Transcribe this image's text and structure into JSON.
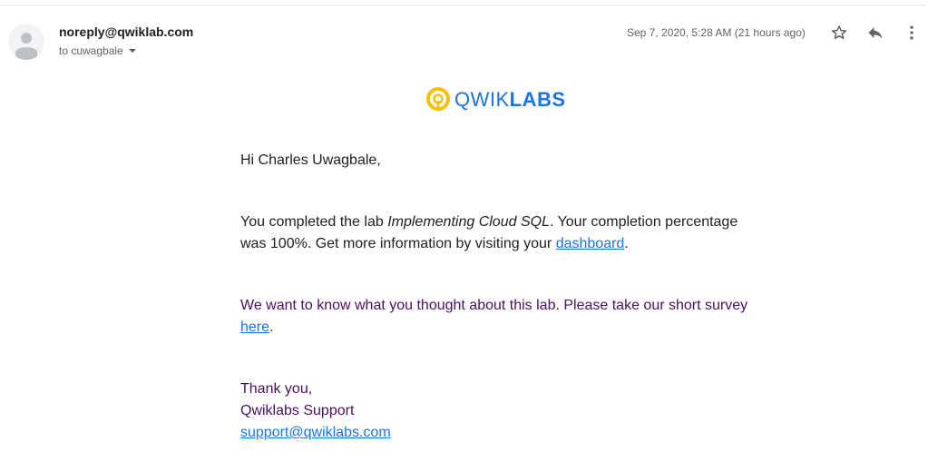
{
  "header": {
    "sender": "noreply@qwiklab.com",
    "recipient": "to cuwagbale",
    "timestamp": "Sep 7, 2020, 5:28 AM (21 hours ago)"
  },
  "icons": {
    "avatar": "person-icon",
    "star": "star-outline-icon",
    "reply": "reply-icon",
    "more": "more-vert-icon"
  },
  "logo": {
    "text_light": "QWIK",
    "text_bold": "LABS"
  },
  "email": {
    "greeting": "Hi Charles Uwagbale,",
    "p1_prefix": "You completed the lab ",
    "p1_lab": "Implementing Cloud SQL",
    "p1_mid": ". Your completion percentage was 100%. Get more information by visiting your ",
    "p1_link": "dashboard",
    "p1_suffix": ".",
    "p2_prefix": "We want to know what you thought about this lab. Please take our short survey ",
    "p2_link": "here",
    "p2_suffix": ".",
    "signoff": "Thank you,",
    "team": "Qwiklabs Support",
    "support_email": "support@qwiklabs.com"
  },
  "colors": {
    "link": "#1a73e8",
    "logo_ring": "#f4c20d",
    "purple_text": "#4a1060"
  }
}
